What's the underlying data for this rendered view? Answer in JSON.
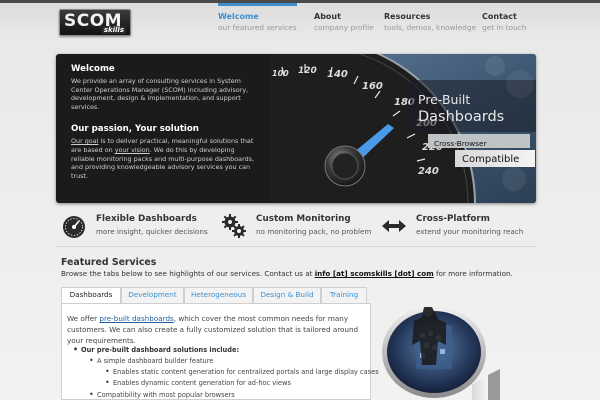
{
  "brand": {
    "logo_main": "SCOM",
    "logo_sub": "skills",
    "accent_color": "#3a8fd0"
  },
  "nav": [
    {
      "title": "Welcome",
      "subtitle": "our featured services",
      "active": true
    },
    {
      "title": "About",
      "subtitle": "company profile"
    },
    {
      "title": "Resources",
      "subtitle": "tools, demos, knowledge"
    },
    {
      "title": "Contact",
      "subtitle": "get in touch"
    }
  ],
  "hero": {
    "welcome_title": "Welcome",
    "welcome_text": "We provide an array of consulting services in System Center Operations Manager (SCOM) including advisory, development, design & implementation, and support services.",
    "passion_title": "Our passion, Your solution",
    "passion_goal": "Our goal",
    "passion_text1": " is to deliver practical, meaningful solutions that are based on ",
    "passion_vision": "your vision",
    "passion_text2": ". We do this by developing reliable monitoring packs and multi-purpose dashboards, and providing knowledgeable advisory services you can trust.",
    "panel_line1": "Pre-Built",
    "panel_line2": "Dashboards",
    "panel_line3": "Cross-Browser",
    "panel_line4": "Compatible",
    "gauge_labels": [
      "100",
      "120",
      "140",
      "160",
      "180",
      "200",
      "220",
      "240"
    ]
  },
  "features": [
    {
      "title": "Flexible Dashboards",
      "subtitle": "more insight, quicker decisions",
      "icon": "speedometer-icon"
    },
    {
      "title": "Custom Monitoring",
      "subtitle": "no monitoring pack, no problem",
      "icon": "gears-icon"
    },
    {
      "title": "Cross-Platform",
      "subtitle": "extend your monitoring reach",
      "icon": "double-arrow-icon"
    }
  ],
  "featured": {
    "title": "Featured Services",
    "desc_before": "Browse the tabs below to see highlights of our services. Contact us at ",
    "email": "info [at] scomskills [dot] com",
    "desc_after": " for more information."
  },
  "tabs": [
    {
      "label": "Dashboards",
      "active": true
    },
    {
      "label": "Development"
    },
    {
      "label": "Heterogeneous"
    },
    {
      "label": "Design & Build"
    },
    {
      "label": "Training"
    }
  ],
  "tab_content": {
    "intro_before": "We offer ",
    "intro_link": "pre-built dashboards",
    "intro_after": ", which cover the most common needs for many customers. We can also create a fully customized solution that is tailored around your requirements.",
    "list_heading": "Our pre-built dashboard solutions include:",
    "item1": "A simple dashboard builder feature",
    "item1a": "Enables static content generation for centralized portals and large display cases",
    "item1b": "Enables dynamic content generation for ad-hoc views",
    "item2": "Compatibility with most popular browsers"
  }
}
